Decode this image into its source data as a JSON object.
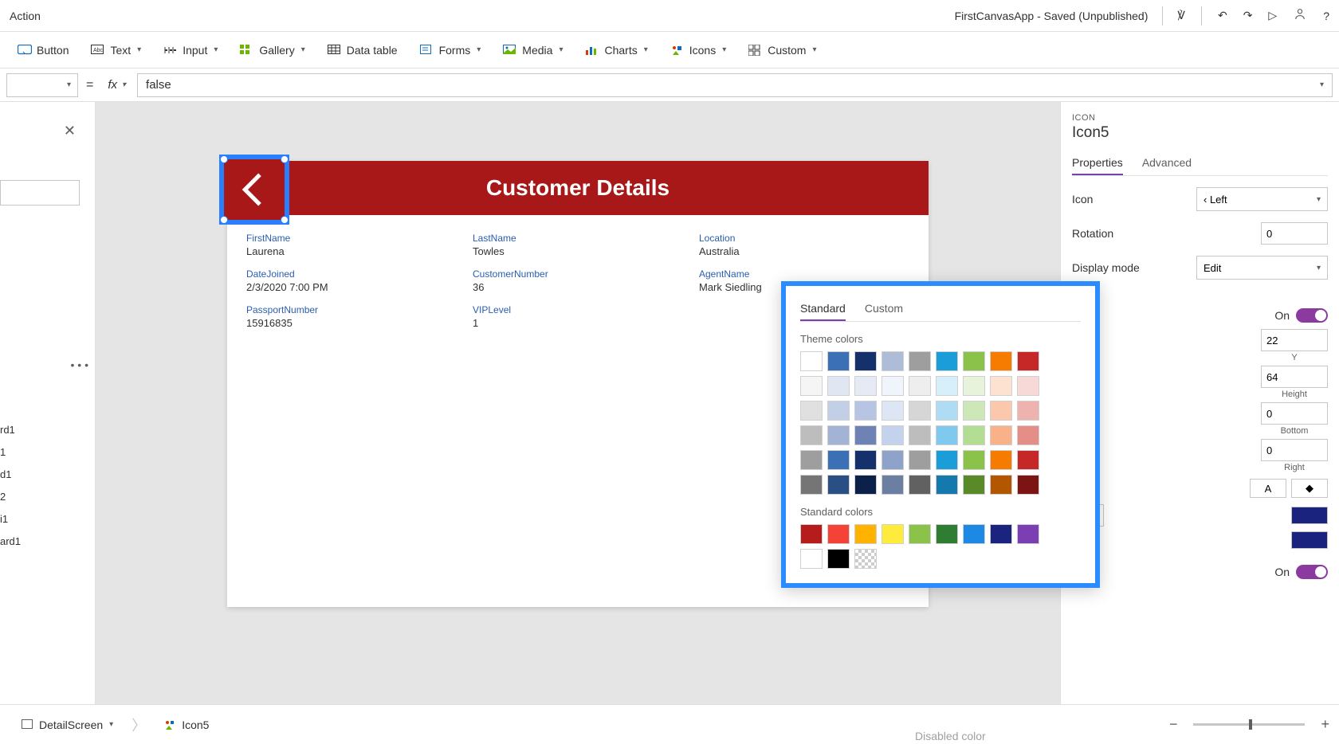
{
  "topbar": {
    "menu": "Action",
    "app_status": "FirstCanvasApp - Saved (Unpublished)"
  },
  "ribbon": {
    "button": "Button",
    "text": "Text",
    "input": "Input",
    "gallery": "Gallery",
    "datatable": "Data table",
    "forms": "Forms",
    "media": "Media",
    "charts": "Charts",
    "icons": "Icons",
    "custom": "Custom"
  },
  "formula": {
    "equals": "=",
    "fx": "fx",
    "value": "false"
  },
  "tree": {
    "more": "• • •",
    "items": [
      "rd1",
      "1",
      "d1",
      "2",
      "i1",
      "ard1"
    ]
  },
  "canvas": {
    "title": "Customer Details",
    "fields": [
      {
        "label": "FirstName",
        "value": "Laurena"
      },
      {
        "label": "LastName",
        "value": "Towles"
      },
      {
        "label": "Location",
        "value": "Australia"
      },
      {
        "label": "DateJoined",
        "value": "2/3/2020 7:00 PM"
      },
      {
        "label": "CustomerNumber",
        "value": "36"
      },
      {
        "label": "AgentName",
        "value": "Mark Siedling"
      },
      {
        "label": "PassportNumber",
        "value": "15916835"
      },
      {
        "label": "VIPLevel",
        "value": "1"
      }
    ]
  },
  "panel": {
    "kind": "ICON",
    "name": "Icon5",
    "tab_props": "Properties",
    "tab_adv": "Advanced",
    "icon_label": "Icon",
    "icon_value": "Left",
    "rotation_label": "Rotation",
    "rotation_value": "0",
    "dispmode_label": "Display mode",
    "dispmode_value": "Edit",
    "on": "On",
    "y_value": "22",
    "y_label": "Y",
    "h_value": "64",
    "h_label": "Height",
    "b_value": "0",
    "b_label": "Bottom",
    "r_value": "0",
    "r_label": "Right",
    "a_letter": "A",
    "num_value": "0",
    "swatch1": "#1a237e",
    "swatch2": "#1a237e",
    "disabled_label": "Disabled color"
  },
  "popup": {
    "tab_std": "Standard",
    "tab_cust": "Custom",
    "theme_label": "Theme colors",
    "std_label": "Standard colors",
    "theme_colors": [
      [
        "#ffffff",
        "#3b6fb6",
        "#14316b",
        "#aebdd7",
        "#9e9e9e",
        "#1b9dd9",
        "#8bc34a",
        "#f57c00",
        "#c62828"
      ],
      [
        "#f5f5f5",
        "#e0e7f3",
        "#e6eaf5",
        "#f0f4fb",
        "#eeeeee",
        "#d7eefb",
        "#e8f3dc",
        "#fde2d2",
        "#f7d9d7"
      ],
      [
        "#e0e0e0",
        "#c3cfe6",
        "#b8c4e4",
        "#dde6f5",
        "#d6d6d6",
        "#afdcf5",
        "#cde8b6",
        "#fbc8ad",
        "#eeb3af"
      ],
      [
        "#bdbdbd",
        "#a3b3d6",
        "#6f82b6",
        "#c3d2ed",
        "#bdbdbd",
        "#7fc9ee",
        "#b3dd92",
        "#f9b189",
        "#e58d87"
      ],
      [
        "#9e9e9e",
        "#3b6fb6",
        "#14316b",
        "#8fa2c9",
        "#9e9e9e",
        "#1b9dd9",
        "#8bc34a",
        "#f57c00",
        "#c62828"
      ],
      [
        "#757575",
        "#2a4f85",
        "#0c214a",
        "#6b7fa3",
        "#616161",
        "#147aad",
        "#5a8a28",
        "#b35600",
        "#7d1414"
      ]
    ],
    "std_colors": [
      [
        "#b71c1c",
        "#f44336",
        "#ffb300",
        "#ffeb3b",
        "#8bc34a",
        "#2e7d32",
        "#1e88e5",
        "#1a237e",
        "#7b3fb3"
      ],
      [
        "#ffffff",
        "#000000",
        "trans"
      ]
    ]
  },
  "statusbar": {
    "screen": "DetailScreen",
    "selection": "Icon5"
  }
}
